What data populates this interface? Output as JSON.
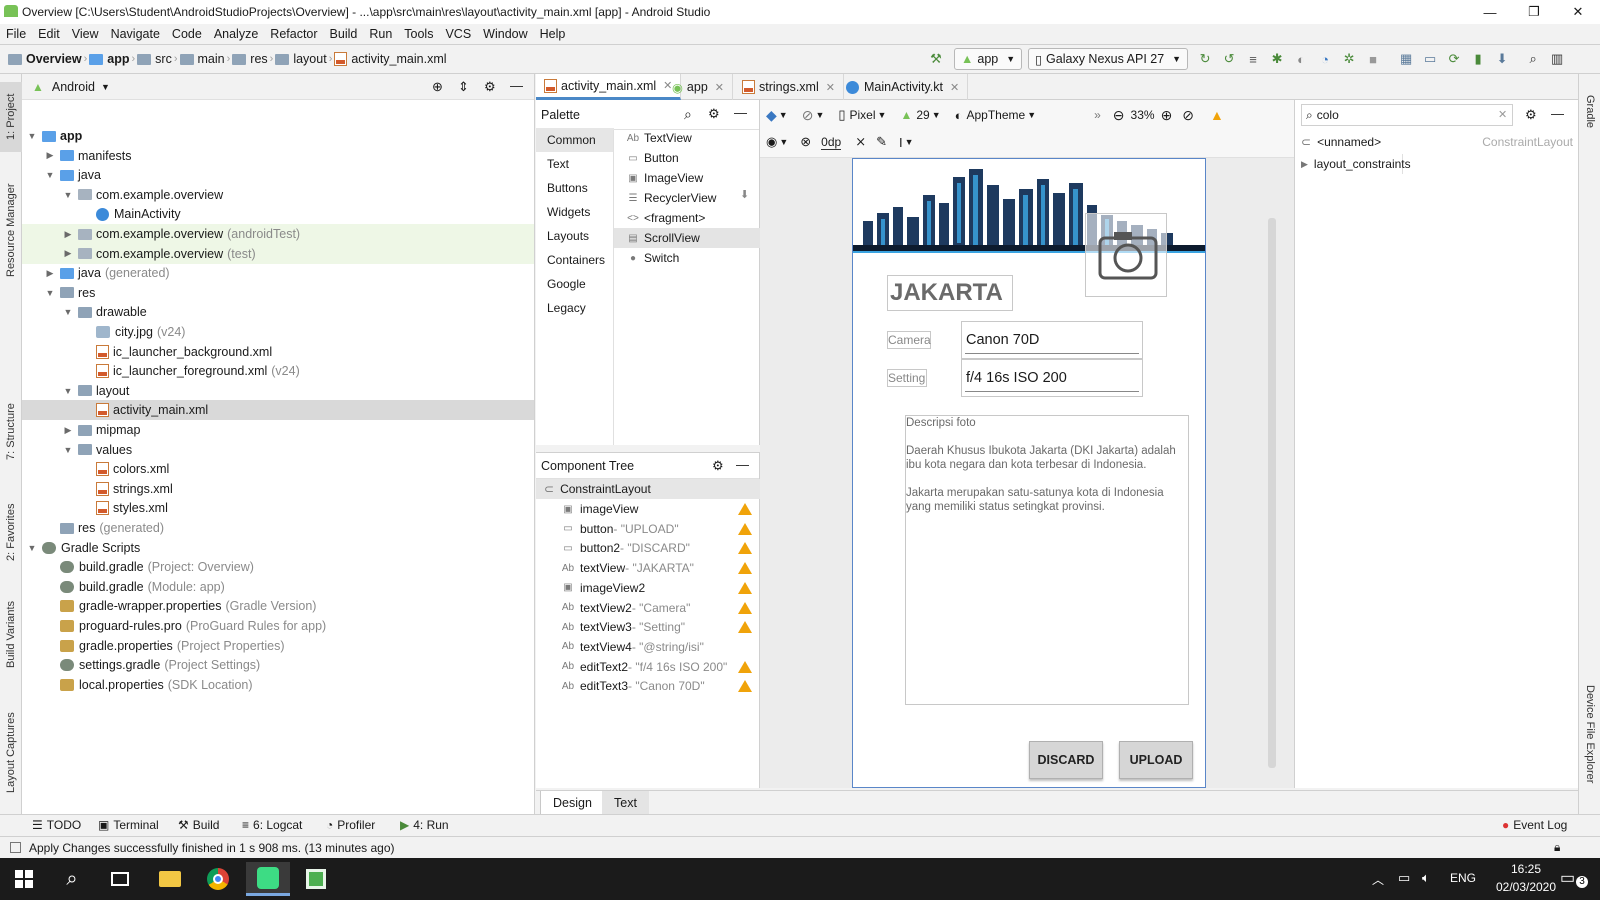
{
  "window": {
    "title": "Overview [C:\\Users\\Student\\AndroidStudioProjects\\Overview] - ...\\app\\src\\main\\res\\layout\\activity_main.xml [app] - Android Studio",
    "minimize": "—",
    "maximize": "❐",
    "close": "✕"
  },
  "menu": [
    "File",
    "Edit",
    "View",
    "Navigate",
    "Code",
    "Analyze",
    "Refactor",
    "Build",
    "Run",
    "Tools",
    "VCS",
    "Window",
    "Help"
  ],
  "breadcrumb": [
    "Overview",
    "app",
    "src",
    "main",
    "res",
    "layout",
    "activity_main.xml"
  ],
  "toolbar": {
    "run_config": "app",
    "device": "Galaxy Nexus API 27"
  },
  "left_tool_tabs": [
    "1: Project",
    "Resource Manager",
    "7: Structure",
    "2: Favorites",
    "Build Variants",
    "Layout Captures"
  ],
  "right_tool_tabs": [
    "Gradle",
    "Device File Explorer"
  ],
  "project": {
    "view": "Android",
    "tree": [
      {
        "label": "app",
        "extra": "",
        "depth": 0,
        "arrow": "▼",
        "icon": "folder-blue",
        "bold": true
      },
      {
        "label": "manifests",
        "extra": "",
        "depth": 1,
        "arrow": "▶",
        "icon": "folder-blue"
      },
      {
        "label": "java",
        "extra": "",
        "depth": 1,
        "arrow": "▼",
        "icon": "folder-blue"
      },
      {
        "label": "com.example.overview",
        "extra": "",
        "depth": 2,
        "arrow": "▼",
        "icon": "package"
      },
      {
        "label": "MainActivity",
        "extra": "",
        "depth": 3,
        "arrow": "",
        "icon": "kotlin"
      },
      {
        "label": "com.example.overview",
        "extra": "(androidTest)",
        "depth": 2,
        "arrow": "▶",
        "icon": "package",
        "green": true
      },
      {
        "label": "com.example.overview",
        "extra": "(test)",
        "depth": 2,
        "arrow": "▶",
        "icon": "package",
        "green": true
      },
      {
        "label": "java",
        "extra": "(generated)",
        "depth": 1,
        "arrow": "▶",
        "icon": "folder-blue"
      },
      {
        "label": "res",
        "extra": "",
        "depth": 1,
        "arrow": "▼",
        "icon": "folder"
      },
      {
        "label": "drawable",
        "extra": "",
        "depth": 2,
        "arrow": "▼",
        "icon": "folder"
      },
      {
        "label": "city.jpg",
        "extra": "(v24)",
        "depth": 3,
        "arrow": "",
        "icon": "image"
      },
      {
        "label": "ic_launcher_background.xml",
        "extra": "",
        "depth": 3,
        "arrow": "",
        "icon": "xml"
      },
      {
        "label": "ic_launcher_foreground.xml",
        "extra": "(v24)",
        "depth": 3,
        "arrow": "",
        "icon": "xml"
      },
      {
        "label": "layout",
        "extra": "",
        "depth": 2,
        "arrow": "▼",
        "icon": "folder"
      },
      {
        "label": "activity_main.xml",
        "extra": "",
        "depth": 3,
        "arrow": "",
        "icon": "xml",
        "selected": true
      },
      {
        "label": "mipmap",
        "extra": "",
        "depth": 2,
        "arrow": "▶",
        "icon": "folder"
      },
      {
        "label": "values",
        "extra": "",
        "depth": 2,
        "arrow": "▼",
        "icon": "folder"
      },
      {
        "label": "colors.xml",
        "extra": "",
        "depth": 3,
        "arrow": "",
        "icon": "xml"
      },
      {
        "label": "strings.xml",
        "extra": "",
        "depth": 3,
        "arrow": "",
        "icon": "xml"
      },
      {
        "label": "styles.xml",
        "extra": "",
        "depth": 3,
        "arrow": "",
        "icon": "xml"
      },
      {
        "label": "res",
        "extra": "(generated)",
        "depth": 1,
        "arrow": "",
        "icon": "folder"
      },
      {
        "label": "Gradle Scripts",
        "extra": "",
        "depth": 0,
        "arrow": "▼",
        "icon": "gradle"
      },
      {
        "label": "build.gradle",
        "extra": "(Project: Overview)",
        "depth": 1,
        "arrow": "",
        "icon": "gradle"
      },
      {
        "label": "build.gradle",
        "extra": "(Module: app)",
        "depth": 1,
        "arrow": "",
        "icon": "gradle"
      },
      {
        "label": "gradle-wrapper.properties",
        "extra": "(Gradle Version)",
        "depth": 1,
        "arrow": "",
        "icon": "props"
      },
      {
        "label": "proguard-rules.pro",
        "extra": "(ProGuard Rules for app)",
        "depth": 1,
        "arrow": "",
        "icon": "props"
      },
      {
        "label": "gradle.properties",
        "extra": "(Project Properties)",
        "depth": 1,
        "arrow": "",
        "icon": "props"
      },
      {
        "label": "settings.gradle",
        "extra": "(Project Settings)",
        "depth": 1,
        "arrow": "",
        "icon": "gradle"
      },
      {
        "label": "local.properties",
        "extra": "(SDK Location)",
        "depth": 1,
        "arrow": "",
        "icon": "props"
      }
    ]
  },
  "editor_tabs": [
    "activity_main.xml",
    "app",
    "strings.xml",
    "MainActivity.kt"
  ],
  "palette": {
    "title": "Palette",
    "categories": [
      "Common",
      "Text",
      "Buttons",
      "Widgets",
      "Layouts",
      "Containers",
      "Google",
      "Legacy"
    ],
    "items": [
      {
        "icon": "Ab",
        "label": "TextView"
      },
      {
        "icon": "▭",
        "label": "Button"
      },
      {
        "icon": "▣",
        "label": "ImageView"
      },
      {
        "icon": "☰",
        "label": "RecyclerView"
      },
      {
        "icon": "<>",
        "label": "<fragment>"
      },
      {
        "icon": "▤",
        "label": "ScrollView"
      },
      {
        "icon": "●",
        "label": "Switch"
      }
    ]
  },
  "component_tree": {
    "title": "Component Tree",
    "root": "ConstraintLayout",
    "items": [
      {
        "icon": "▣",
        "id": "imageView",
        "desc": "",
        "warn": true
      },
      {
        "icon": "▭",
        "id": "button",
        "desc": "- \"UPLOAD\"",
        "warn": true
      },
      {
        "icon": "▭",
        "id": "button2",
        "desc": "- \"DISCARD\"",
        "warn": true
      },
      {
        "icon": "Ab",
        "id": "textView",
        "desc": "- \"JAKARTA\"",
        "warn": true
      },
      {
        "icon": "▣",
        "id": "imageView2",
        "desc": "",
        "warn": true
      },
      {
        "icon": "Ab",
        "id": "textView2",
        "desc": "- \"Camera\"",
        "warn": true
      },
      {
        "icon": "Ab",
        "id": "textView3",
        "desc": "- \"Setting\"",
        "warn": true
      },
      {
        "icon": "Ab",
        "id": "textView4",
        "desc": "- \"@string/isi\"",
        "warn": false
      },
      {
        "icon": "Ab",
        "id": "editText2",
        "desc": "- \"f/4 16s ISO 200\"",
        "warn": true
      },
      {
        "icon": "Ab",
        "id": "editText3",
        "desc": "- \"Canon 70D\"",
        "warn": true
      }
    ]
  },
  "design_toolbar": {
    "device": "Pixel",
    "api": "29",
    "theme": "AppTheme",
    "zoom": "33%",
    "margin": "0dp"
  },
  "phone": {
    "city_label": "JAKARTA",
    "camera_label": "Camera",
    "camera_value": "Canon 70D",
    "setting_label": "Setting",
    "setting_value": "f/4 16s ISO 200",
    "desc_title": "Descripsi foto",
    "desc_p1": " Daerah Khusus Ibukota Jakarta (DKI Jakarta) adalah ibu kota negara dan kota terbesar di Indonesia.",
    "desc_p2": " Jakarta merupakan satu-satunya kota di Indonesia yang memiliki status setingkat provinsi.",
    "discard": "DISCARD",
    "upload": "UPLOAD"
  },
  "attributes": {
    "search": "colo",
    "component": "<unnamed>",
    "type": "ConstraintLayout",
    "group": "layout_constraints"
  },
  "design_tabs": [
    "Design",
    "Text"
  ],
  "bottom_tools": [
    "TODO",
    "Terminal",
    "Build",
    "6: Logcat",
    "Profiler",
    "4: Run"
  ],
  "event_log": "Event Log",
  "status": "Apply Changes successfully finished in 1 s 908 ms. (13 minutes ago)",
  "taskbar": {
    "lang": "ENG",
    "time": "16:25",
    "date": "02/03/2020",
    "notif": "3"
  }
}
